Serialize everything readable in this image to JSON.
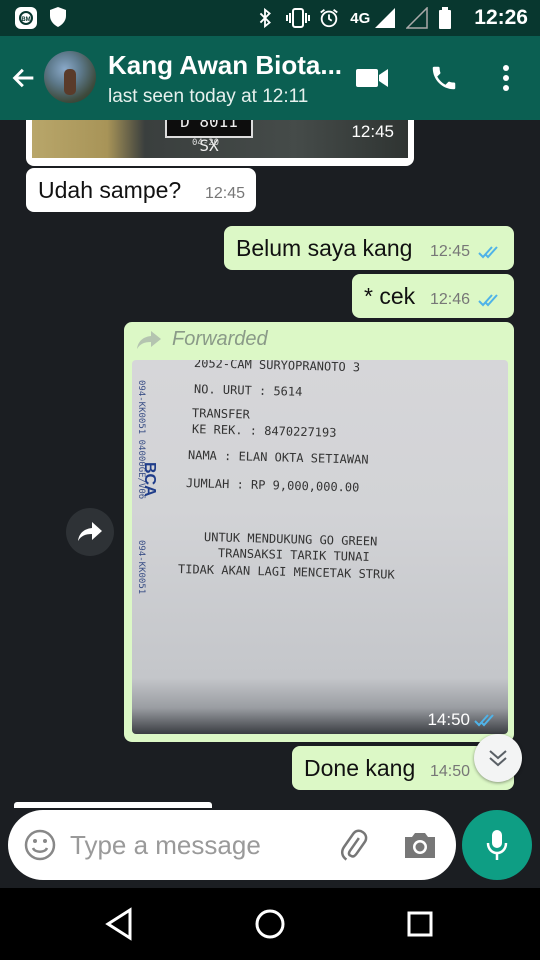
{
  "status_bar": {
    "network": "4G",
    "time": "12:26",
    "icons": [
      "app-notification-icon",
      "shield-icon",
      "bluetooth-icon",
      "vibrate-icon",
      "alarm-icon",
      "signal-icon",
      "signal-empty-icon",
      "battery-icon"
    ]
  },
  "header": {
    "contact_name": "Kang Awan Biota...",
    "status": "last seen today at 12:11",
    "icons": [
      "back-arrow-icon",
      "video-call-icon",
      "phone-icon",
      "more-vert-icon"
    ]
  },
  "messages": [
    {
      "type": "image",
      "direction": "in",
      "plate_text": "D 8011 SX",
      "plate_sub": "04-20",
      "time": "12:45"
    },
    {
      "type": "text",
      "direction": "in",
      "text": "Udah sampe?",
      "time": "12:45"
    },
    {
      "type": "text",
      "direction": "out",
      "text": "Belum saya kang",
      "time": "12:45",
      "status": "read"
    },
    {
      "type": "text",
      "direction": "out",
      "text": "* cek",
      "time": "12:46",
      "status": "read"
    },
    {
      "type": "forwarded_image",
      "direction": "out",
      "forward_label": "Forwarded",
      "time": "14:50",
      "status": "read",
      "receipt": {
        "lines": [
          "2052-CAM SURYOPRANOTO 3",
          "NO. URUT : 5614",
          "TRANSFER",
          "KE REK.  : 8470227193",
          "NAMA     : ELAN OKTA SETIAWAN",
          "JUMLAH   : RP         9,000,000.00",
          "UNTUK MENDUKUNG GO GREEN",
          "TRANSAKSI TARIK TUNAI",
          "TIDAK AKAN LAGI MENCETAK STRUK"
        ],
        "bank_logo": "BCA",
        "side_text_top": "094-KK0051 04000GE/V06",
        "side_text_bottom": "094-KK0051"
      }
    },
    {
      "type": "text",
      "direction": "out",
      "text": "Done kang",
      "time": "14:50",
      "status": "read"
    }
  ],
  "input": {
    "placeholder": "Type a message",
    "value": ""
  },
  "colors": {
    "header": "#0b5f52",
    "status_bar": "#08372f",
    "outgoing_bubble": "#dcf8c6",
    "incoming_bubble": "#ffffff",
    "read_ticks": "#4fb3e8",
    "mic_button": "#0e9e84",
    "chat_background": "#1b1e22"
  }
}
